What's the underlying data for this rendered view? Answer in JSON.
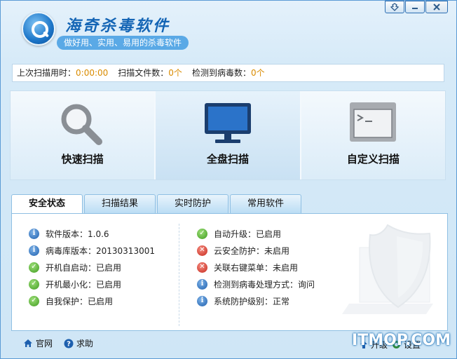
{
  "app": {
    "title": "海奇杀毒软件",
    "slogan": "做好用、实用、易用的杀毒软件"
  },
  "window_controls": [
    "skin-icon",
    "minimize-icon",
    "close-icon"
  ],
  "stats": {
    "last_scan_label": "上次扫描用时：",
    "last_scan_value": "0:00:00",
    "files_label": "扫描文件数：",
    "files_value": "0个",
    "viruses_label": "检测到病毒数：",
    "viruses_value": "0个"
  },
  "scan_buttons": [
    {
      "label": "快速扫描",
      "icon": "magnifier-icon"
    },
    {
      "label": "全盘扫描",
      "icon": "monitor-icon"
    },
    {
      "label": "自定义扫描",
      "icon": "terminal-icon"
    }
  ],
  "tabs": [
    "安全状态",
    "扫描结果",
    "实时防护",
    "常用软件"
  ],
  "active_tab": 0,
  "status_left": [
    {
      "type": "info",
      "text": "软件版本：1.0.6"
    },
    {
      "type": "info",
      "text": "病毒库版本：20130313001"
    },
    {
      "type": "ok",
      "text": "开机自启动：已启用"
    },
    {
      "type": "ok",
      "text": "开机最小化：已启用"
    },
    {
      "type": "ok",
      "text": "自我保护：已启用"
    }
  ],
  "status_right": [
    {
      "type": "ok",
      "text": "自动升级：已启用"
    },
    {
      "type": "err",
      "text": "云安全防护：未启用"
    },
    {
      "type": "err",
      "text": "关联右键菜单：未启用"
    },
    {
      "type": "info",
      "text": "检测到病毒处理方式：询问"
    },
    {
      "type": "info",
      "text": "系统防护级别：正常"
    }
  ],
  "footer": {
    "links": [
      {
        "label": "官网",
        "icon": "home-icon"
      },
      {
        "label": "求助",
        "icon": "help-icon"
      }
    ],
    "tools": [
      {
        "label": "升级",
        "icon": "upgrade-icon"
      },
      {
        "label": "设置",
        "icon": "settings-icon"
      }
    ],
    "watermark": "ITMOP.COM"
  },
  "colors": {
    "accent": "#1465b5",
    "value_orange": "#d98b00",
    "ok_green": "#3e9a1d",
    "err_red": "#c6281c",
    "info_blue": "#1d5fae"
  }
}
